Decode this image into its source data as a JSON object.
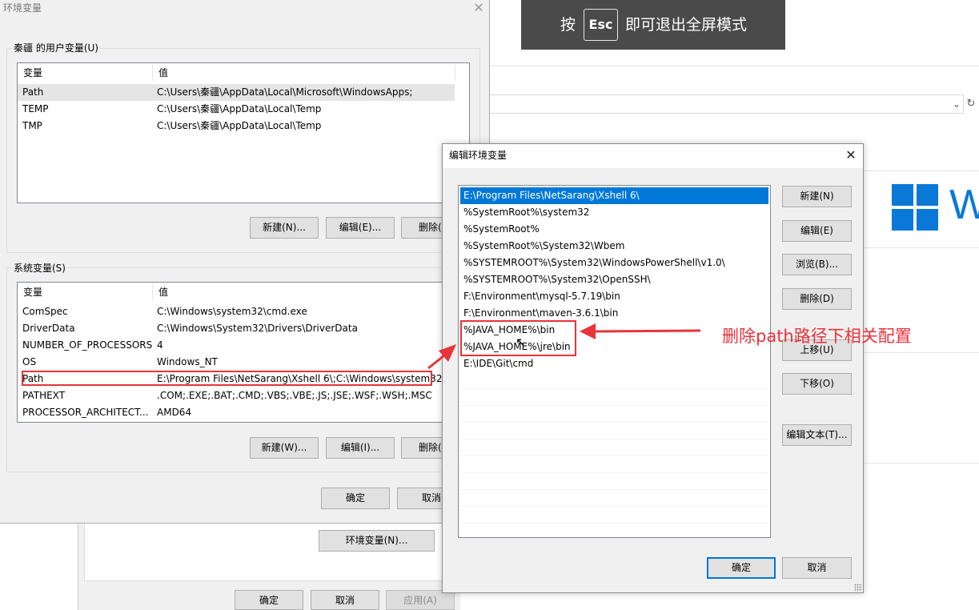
{
  "colors": {
    "selection": "#0078d7",
    "annotation": "#e8333a",
    "banner_bg": "#4a4a4a"
  },
  "banner": {
    "before": "按",
    "key": "Esc",
    "after": "即可退出全屏模式"
  },
  "env_dialog": {
    "title": "环境变量",
    "user_group_title": "秦疆 的用户变量(U)",
    "col_var": "变量",
    "col_val": "值",
    "user_vars": [
      {
        "name": "Path",
        "value": "C:\\Users\\秦疆\\AppData\\Local\\Microsoft\\WindowsApps;"
      },
      {
        "name": "TEMP",
        "value": "C:\\Users\\秦疆\\AppData\\Local\\Temp"
      },
      {
        "name": "TMP",
        "value": "C:\\Users\\秦疆\\AppData\\Local\\Temp"
      }
    ],
    "user_buttons": {
      "new": "新建(N)...",
      "edit": "编辑(E)...",
      "delete": "删除("
    },
    "sys_group_title": "系统变量(S)",
    "sys_vars": [
      {
        "name": "ComSpec",
        "value": "C:\\Windows\\system32\\cmd.exe"
      },
      {
        "name": "DriverData",
        "value": "C:\\Windows\\System32\\Drivers\\DriverData"
      },
      {
        "name": "NUMBER_OF_PROCESSORS",
        "value": "4"
      },
      {
        "name": "OS",
        "value": "Windows_NT"
      },
      {
        "name": "Path",
        "value": "E:\\Program Files\\NetSarang\\Xshell 6\\;C:\\Windows\\system32;..."
      },
      {
        "name": "PATHEXT",
        "value": ".COM;.EXE;.BAT;.CMD;.VBS;.VBE;.JS;.JSE;.WSF;.WSH;.MSC"
      },
      {
        "name": "PROCESSOR_ARCHITECT...",
        "value": "AMD64"
      }
    ],
    "sys_buttons": {
      "new": "新建(W)...",
      "edit": "编辑(I)...",
      "delete": "删除("
    },
    "ok": "确定",
    "cancel": "取消"
  },
  "sysprops": {
    "env_button": "环境变量(N)...",
    "ok": "确定",
    "cancel": "取消",
    "apply": "应用(A)"
  },
  "edit_dialog": {
    "title": "编辑环境变量",
    "entries": [
      "E:\\Program Files\\NetSarang\\Xshell 6\\",
      "%SystemRoot%\\system32",
      "%SystemRoot%",
      "%SystemRoot%\\System32\\Wbem",
      "%SYSTEMROOT%\\System32\\WindowsPowerShell\\v1.0\\",
      "%SYSTEMROOT%\\System32\\OpenSSH\\",
      "F:\\Environment\\mysql-5.7.19\\bin",
      "F:\\Environment\\maven-3.6.1\\bin",
      "%JAVA_HOME%\\bin",
      "%JAVA_HOME%\\jre\\bin",
      "E:\\IDE\\Git\\cmd"
    ],
    "buttons": {
      "new": "新建(N)",
      "edit": "编辑(E)",
      "browse": "浏览(B)...",
      "delete": "删除(D)",
      "up": "上移(U)",
      "down": "下移(O)",
      "edit_text": "编辑文本(T)..."
    },
    "ok": "确定",
    "cancel": "取消"
  },
  "annotation": {
    "text": "删除path路径下相关配置"
  },
  "background_window": {
    "logo_letter": "W"
  }
}
